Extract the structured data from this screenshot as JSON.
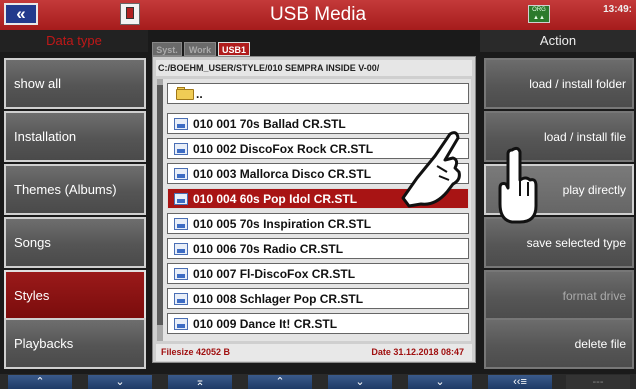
{
  "header": {
    "title": "USB Media",
    "clock": "13:49:"
  },
  "left": {
    "heading": "Data type",
    "items": [
      {
        "label": "show all"
      },
      {
        "label": "Installation"
      },
      {
        "label": "Themes (Albums)"
      },
      {
        "label": "Songs"
      },
      {
        "label": "Styles",
        "selected": true
      },
      {
        "label": "Playbacks"
      }
    ]
  },
  "tabs": [
    {
      "label": "Syst."
    },
    {
      "label": "Work"
    },
    {
      "label": "USB1",
      "active": true
    }
  ],
  "browser": {
    "path": "C:/BOEHM_USER/STYLE/010 SEMPRA INSIDE V-00/",
    "parent_label": "..",
    "files": [
      {
        "name": "010 001 70s Ballad CR.STL"
      },
      {
        "name": "010 002 DiscoFox Rock CR.STL"
      },
      {
        "name": "010 003 Mallorca Disco CR.STL"
      },
      {
        "name": "010 004 60s Pop Idol CR.STL",
        "selected": true
      },
      {
        "name": "010 005 70s Inspiration CR.STL"
      },
      {
        "name": "010 006 70s Radio CR.STL"
      },
      {
        "name": "010 007 Fl-DiscoFox CR.STL"
      },
      {
        "name": "010 008 Schlager Pop CR.STL"
      },
      {
        "name": "010 009 Dance It! CR.STL"
      }
    ],
    "filesize": "Filesize 42052 B",
    "date": "Date 31.12.2018  08:47"
  },
  "actions": {
    "heading": "Action",
    "items": [
      {
        "label": "load  /  install folder"
      },
      {
        "label": "load  /  install file"
      },
      {
        "label": "play directly"
      },
      {
        "label": "save selected type"
      },
      {
        "label": "format drive"
      },
      {
        "label": "delete file"
      }
    ]
  },
  "bottom": {
    "buttons": [
      {
        "label": "⌃"
      },
      {
        "label": "⌄"
      },
      {
        "label": "⌅"
      },
      {
        "label": "⌃"
      },
      {
        "label": "⌄"
      },
      {
        "label": "⌄"
      },
      {
        "label": "‹‹≡"
      },
      {
        "label": "---"
      }
    ]
  },
  "colors": {
    "accent": "#b01c1c",
    "header": "#c43a3a"
  }
}
